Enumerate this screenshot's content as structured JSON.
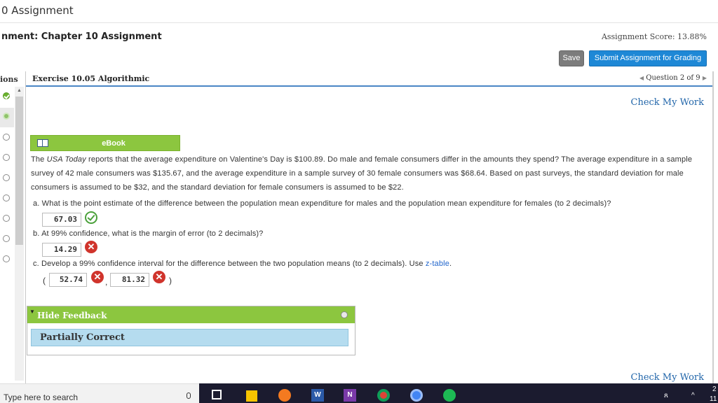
{
  "window": {
    "title": "0 Assignment"
  },
  "header": {
    "assignment_name": "nment: Chapter 10 Assignment",
    "score": "Assignment Score: 13.88%",
    "save_label": "Save",
    "submit_label": "Submit Assignment for Grading"
  },
  "sidebar": {
    "label": "ions",
    "questions": [
      {
        "status": "correct"
      },
      {
        "status": "current"
      },
      {
        "status": "open"
      },
      {
        "status": "open"
      },
      {
        "status": "open"
      },
      {
        "status": "open"
      },
      {
        "status": "open"
      },
      {
        "status": "open"
      },
      {
        "status": "open"
      }
    ]
  },
  "tabbar": {
    "exercise": "Exercise 10.05 Algorithmic",
    "question_nav": "Question 2 of 9"
  },
  "content": {
    "check_my_work": "Check My Work",
    "ebook_label": "eBook",
    "problem": {
      "prefix": "The ",
      "source": "USA Today",
      "text": " reports that the average expenditure on Valentine's Day is $100.89. Do male and female consumers differ in the amounts they spend? The average expenditure in a sample survey of 42 male consumers was $135.67, and the average expenditure in a sample survey of 30 female consumers was $68.64. Based on past surveys, the standard deviation for male consumers is assumed to be $32, and the standard deviation for female consumers is assumed to be $22."
    },
    "parts": {
      "a": {
        "question": "a. What is the point estimate of the difference between the population mean expenditure for males and the population mean expenditure for females (to 2 decimals)?",
        "answer": "67.03",
        "status": "correct"
      },
      "b": {
        "question": "b. At 99% confidence, what is the margin of error (to 2 decimals)?",
        "answer": "14.29",
        "status": "incorrect"
      },
      "c": {
        "question_prefix": "c. Develop a 99% confidence interval for the difference between the two population means (to 2 decimals). Use ",
        "link": "z-table",
        "question_suffix": ".",
        "open_paren": "(",
        "lower": "52.74",
        "separator": ",",
        "upper": "81.32",
        "close_paren": ")",
        "status": "incorrect"
      }
    },
    "feedback": {
      "toggle_label": "Hide Feedback",
      "result": "Partially Correct"
    }
  },
  "taskbar": {
    "search_placeholder": "Type here to search",
    "apps": [
      "task-view",
      "store",
      "firefox",
      "word",
      "onenote",
      "chrome",
      "chrome-alt",
      "spotify"
    ],
    "clock_partial": "2",
    "clock_partial_2": "11"
  },
  "colors": {
    "accent_green": "#8cc63f",
    "link_blue": "#2266aa",
    "submit_blue": "#1e88d6",
    "error_red": "#d0342c",
    "feedback_blue": "#b5dcef"
  }
}
